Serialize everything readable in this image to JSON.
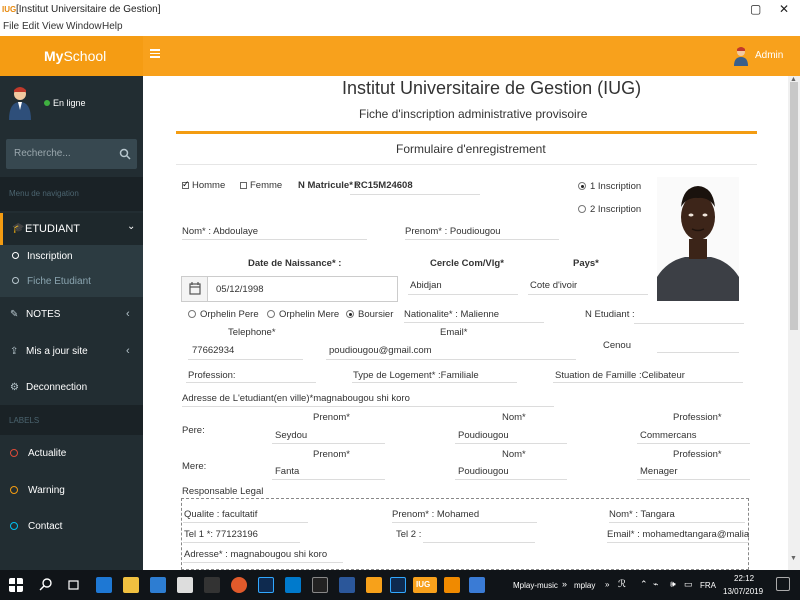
{
  "window": {
    "app_icon_label": "IUG",
    "title": "[Institut Universitaire de Gestion]",
    "menu": [
      "File",
      "Edit",
      "View",
      "Window",
      "Help"
    ]
  },
  "header": {
    "brand_prefix": "My",
    "brand_suffix": "School",
    "admin_label": "Admin",
    "accent_color": "#f8a11c"
  },
  "sidebar": {
    "status": "En ligne",
    "search_placeholder": "Recherche...",
    "nav_header": "Menu de navigation",
    "etudiant_label": "ETUDIANT",
    "sub_items": [
      "Inscription",
      "Fiche Etudiant"
    ],
    "notes_label": "NOTES",
    "maj_label": "Mis a jour site",
    "deconnexion_label": "Deconnection",
    "labels_header": "LABELS",
    "label_items": [
      {
        "label": "Actualite",
        "color": "#dd4b39"
      },
      {
        "label": "Warning",
        "color": "#f39c12"
      },
      {
        "label": "Contact",
        "color": "#00c0ef"
      }
    ]
  },
  "page": {
    "institution": "Institut Universitaire de Gestion (IUG)",
    "subtitle": "Fiche d'inscription administrative provisoire",
    "form_title": "Formulaire d'enregistrement"
  },
  "form": {
    "homme": "Homme",
    "femme": "Femme",
    "matricule_label": "N Matricule* :",
    "matricule_value": "RC15M24608",
    "inscription1": "1 Inscription",
    "inscription2": "2 Inscription",
    "nom": "Nom* : Abdoulaye",
    "prenom": "Prenom* : Poudiougou",
    "dob_label": "Date de Naissance* :",
    "cercle_label": "Cercle Com/Vlg*",
    "pays_label": "Pays*",
    "dob_value": "05/12/1998",
    "cercle_value": "Abidjan",
    "pays_value": "Cote d'ivoir",
    "orph_pere": "Orphelin Pere",
    "orph_mere": "Orphelin Mere",
    "boursier": "Boursier",
    "nationalite": "Nationalite* : Malienne",
    "n_etudiant": "N Etudiant :",
    "telephone_label": "Telephone*",
    "email_label": "Email*",
    "telephone_value": "77662934",
    "email_value": "poudiougou@gmail.com",
    "cenou": "Cenou",
    "profession": "Profession:",
    "logement": "Type de Logement* :Familiale",
    "situation": "Stuation de Famille :Celibateur",
    "adresse": "Adresse de L'etudiant(en ville)*magnabougou shi koro",
    "prenom_head": "Prenom*",
    "nom_head": "Nom*",
    "profession_head": "Profession*",
    "pere_label": "Pere:",
    "pere_prenom": "Seydou",
    "pere_nom": "Poudiougou",
    "pere_profession": "Commercans",
    "mere_label": "Mere:",
    "mere_prenom": "Fanta",
    "mere_nom": "Poudiougou",
    "mere_profession": "Menager",
    "responsable": "Responsable Legal",
    "qualite": "Qualite : facultatif",
    "resp_prenom": "Prenom* : Mohamed",
    "resp_nom": "Nom* : Tangara",
    "tel1": "Tel 1 *: 77123196",
    "tel2": "Tel 2 :",
    "resp_email": "Email* : mohamedtangara@maliantu",
    "resp_adresse": "Adresse* : magnabougou shi koro"
  },
  "taskbar": {
    "app_mplay_music": "Mplay-music",
    "app_mplay": "mplay",
    "lang": "FRA",
    "time": "22:12",
    "date": "13/07/2019",
    "iug_label": "IUG"
  }
}
